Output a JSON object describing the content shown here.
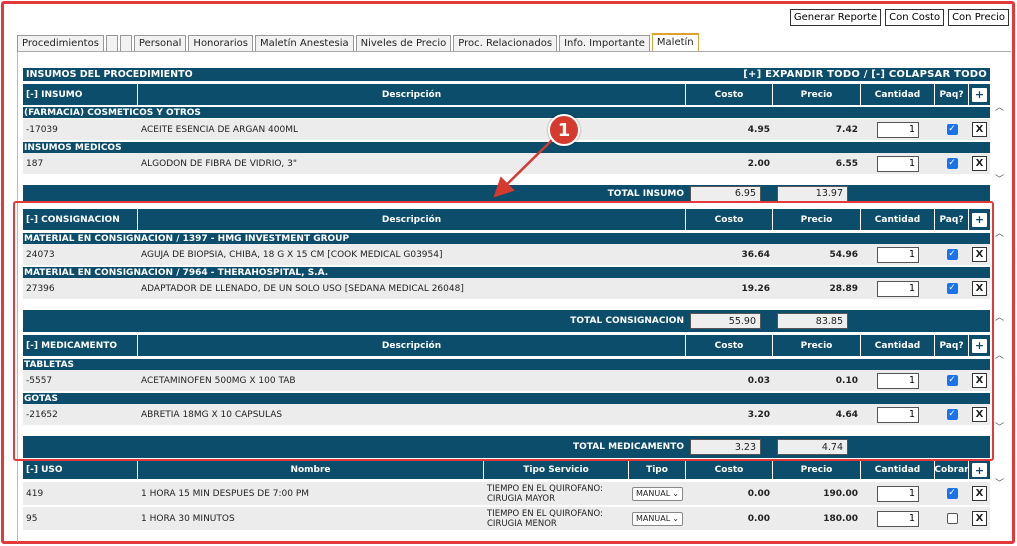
{
  "toolbar": {
    "generar_reporte": "Generar Reporte",
    "con_costo": "Con Costo",
    "con_precio": "Con Precio"
  },
  "tabs": [
    {
      "label": "Procedimientos"
    },
    {
      "label": ""
    },
    {
      "label": ""
    },
    {
      "label": "Personal"
    },
    {
      "label": "Honorarios"
    },
    {
      "label": "Maletín Anestesia"
    },
    {
      "label": "Niveles de Precio"
    },
    {
      "label": "Proc. Relacionados"
    },
    {
      "label": "Info. Importante"
    },
    {
      "label": "Maletín",
      "active": true
    }
  ],
  "section_title": "INSUMOS DEL PROCEDIMIENTO",
  "expand_label": "[+] EXPANDIR TODO / [-] COLAPSAR TODO",
  "insumo": {
    "header": {
      "col1": "[-] INSUMO",
      "desc": "Descripción",
      "costo": "Costo",
      "precio": "Precio",
      "cantidad": "Cantidad",
      "paq": "Paq?"
    },
    "groups": [
      {
        "name": "(FARMACIA) COSMETICOS Y OTROS",
        "items": [
          {
            "code": "-17039",
            "desc": "ACEITE ESENCIA DE ARGAN 400ML",
            "costo": "4.95",
            "precio": "7.42",
            "qty": "1",
            "paq": true
          }
        ]
      },
      {
        "name": "INSUMOS MEDICOS",
        "items": [
          {
            "code": "187",
            "desc": "ALGODON DE FIBRA DE VIDRIO, 3\"",
            "costo": "2.00",
            "precio": "6.55",
            "qty": "1",
            "paq": true
          }
        ]
      }
    ],
    "total_label": "TOTAL INSUMO",
    "total_costo": "6.95",
    "total_precio": "13.97"
  },
  "consignacion": {
    "header": {
      "col1": "[-] CONSIGNACION",
      "desc": "Descripción",
      "costo": "Costo",
      "precio": "Precio",
      "cantidad": "Cantidad",
      "paq": "Paq?"
    },
    "groups": [
      {
        "name": "MATERIAL EN CONSIGNACION / 1397 - HMG INVESTMENT GROUP",
        "items": [
          {
            "code": "24073",
            "desc": "AGUJA DE BIOPSIA, CHIBA, 18 G X 15 CM [COOK MEDICAL G03954]",
            "costo": "36.64",
            "precio": "54.96",
            "qty": "1",
            "paq": true
          }
        ]
      },
      {
        "name": "MATERIAL EN CONSIGNACION / 7964 - THERAHOSPITAL, S.A.",
        "items": [
          {
            "code": "27396",
            "desc": "ADAPTADOR DE LLENADO, DE UN SOLO USO [SEDANA MEDICAL 26048]",
            "costo": "19.26",
            "precio": "28.89",
            "qty": "1",
            "paq": true
          }
        ]
      }
    ],
    "total_label": "TOTAL CONSIGNACION",
    "total_costo": "55.90",
    "total_precio": "83.85"
  },
  "medicamento": {
    "header": {
      "col1": "[-] MEDICAMENTO",
      "desc": "Descripción",
      "costo": "Costo",
      "precio": "Precio",
      "cantidad": "Cantidad",
      "paq": "Paq?"
    },
    "groups": [
      {
        "name": "TABLETAS",
        "items": [
          {
            "code": "-5557",
            "desc": "ACETAMINOFEN 500MG X 100 TAB",
            "costo": "0.03",
            "precio": "0.10",
            "qty": "1",
            "paq": true
          }
        ]
      },
      {
        "name": "GOTAS",
        "items": [
          {
            "code": "-21652",
            "desc": "ABRETIA 18MG X 10 CAPSULAS",
            "costo": "3.20",
            "precio": "4.64",
            "qty": "1",
            "paq": true
          }
        ]
      }
    ],
    "total_label": "TOTAL MEDICAMENTO",
    "total_costo": "3.23",
    "total_precio": "4.74"
  },
  "uso": {
    "header": {
      "col1": "[-] USO",
      "nombre": "Nombre",
      "tipo_servicio": "Tipo Servicio",
      "tipo": "Tipo",
      "costo": "Costo",
      "precio": "Precio",
      "cantidad": "Cantidad",
      "cobrar": "Cobrar"
    },
    "items": [
      {
        "code": "419",
        "nombre": "1 HORA 15 MIN DESPUES DE 7:00 PM",
        "tipo_servicio": "TIEMPO EN EL QUIROFANO: CIRUGIA MAYOR",
        "tipo": "MANUAL",
        "costo": "0.00",
        "precio": "190.00",
        "qty": "1",
        "cobrar": true
      },
      {
        "code": "95",
        "nombre": "1 HORA 30 MINUTOS",
        "tipo_servicio": "TIEMPO EN EL QUIROFANO: CIRUGIA MENOR",
        "tipo": "MANUAL",
        "costo": "0.00",
        "precio": "180.00",
        "qty": "1",
        "cobrar": false
      }
    ]
  },
  "icons": {
    "plus": "+",
    "remove": "X",
    "check": "✓",
    "chevron": "⌄"
  },
  "annotation": {
    "badge": "1"
  },
  "colors": {
    "header_bg": "#0b4d6b",
    "row_bg": "#ececec",
    "highlight": "#e23a3a",
    "checkbox": "#1a73e8"
  }
}
